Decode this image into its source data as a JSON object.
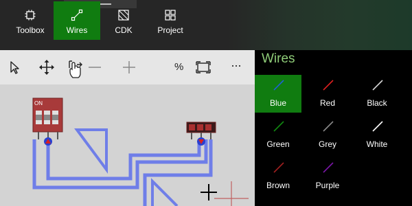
{
  "nav": {
    "tabs": [
      {
        "label": "Toolbox",
        "icon": "chip-icon",
        "active": false
      },
      {
        "label": "Wires",
        "icon": "wire-icon",
        "active": true
      },
      {
        "label": "CDK",
        "icon": "cdk-icon",
        "active": false
      },
      {
        "label": "Project",
        "icon": "grid-icon",
        "active": false
      }
    ]
  },
  "toolbar": {
    "percent_label": "%",
    "more_label": "···"
  },
  "canvas": {
    "dip_switch_label": "ON"
  },
  "panel": {
    "title": "Wires",
    "wires": [
      {
        "label": "Blue",
        "color": "#1f5fd6",
        "active": true
      },
      {
        "label": "Red",
        "color": "#e02020"
      },
      {
        "label": "Black",
        "color": "#d8d8d8"
      },
      {
        "label": "Green",
        "color": "#118a11"
      },
      {
        "label": "Grey",
        "color": "#8a8a8a"
      },
      {
        "label": "White",
        "color": "#ffffff"
      },
      {
        "label": "Brown",
        "color": "#a02020"
      },
      {
        "label": "Purple",
        "color": "#7a16a8"
      }
    ]
  },
  "colors": {
    "accent": "#107c10",
    "panel_title": "#8fcc78",
    "wire_blue": "#6f7ee8",
    "component_red": "#a83a3a"
  }
}
